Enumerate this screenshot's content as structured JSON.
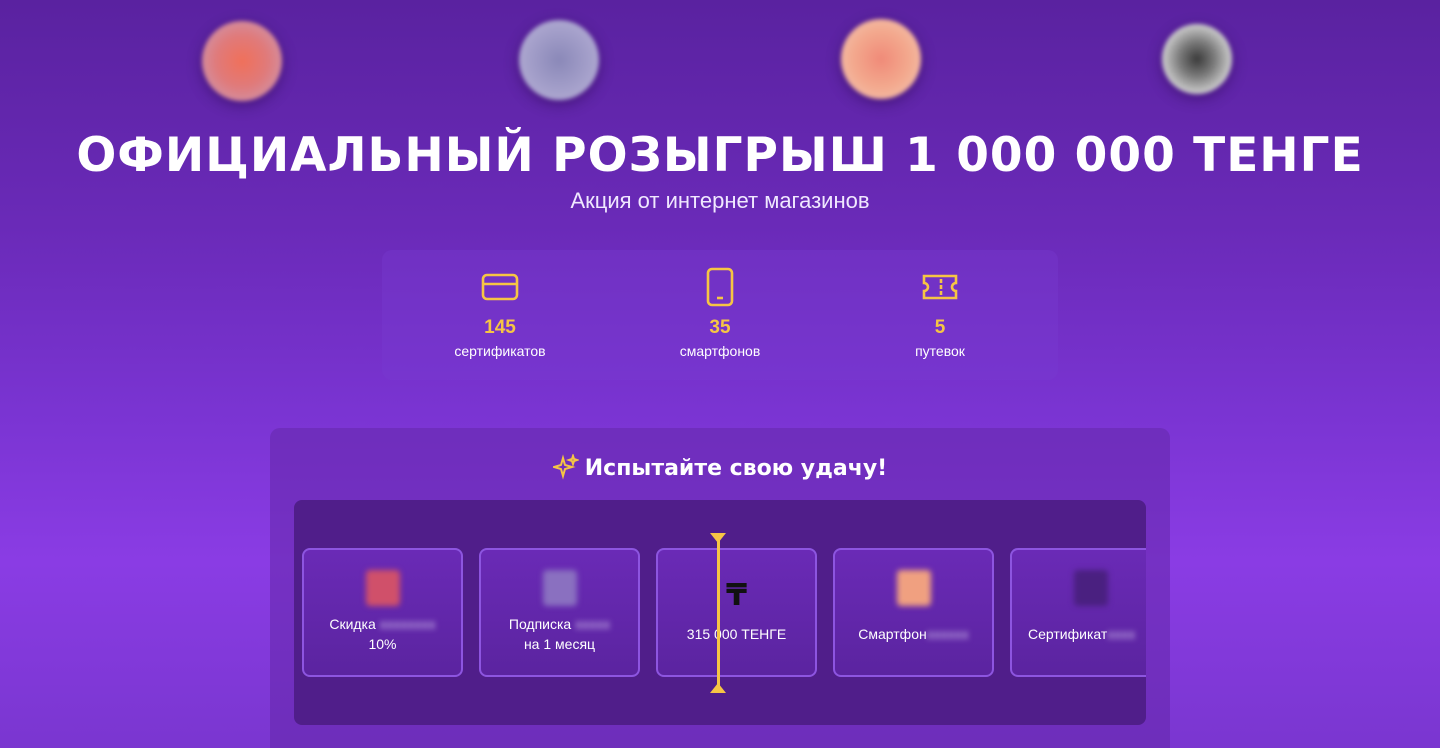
{
  "header": {
    "title": "ОФИЦИАЛЬНЫЙ РОЗЫГРЫШ 1 000 000 ТЕНГЕ",
    "subtitle": "Акция от интернет магазинов"
  },
  "stats": [
    {
      "icon": "credit-card-icon",
      "value": "145",
      "label": "сертификатов"
    },
    {
      "icon": "smartphone-icon",
      "value": "35",
      "label": "смартфонов"
    },
    {
      "icon": "ticket-icon",
      "value": "5",
      "label": "путевок"
    }
  ],
  "game": {
    "title": "Испытайте свою удачу!",
    "cards": [
      {
        "line1": "Скидка",
        "line2": "10%"
      },
      {
        "line1": "Подписка",
        "line2": "на 1 месяц"
      },
      {
        "symbol": "₸",
        "line1": "315 000 ТЕНГЕ"
      },
      {
        "line1": "Смартфон"
      },
      {
        "line1": "Сертификат"
      }
    ]
  },
  "colors": {
    "accent": "#f6c544",
    "reel_bg": "#501e8a"
  }
}
